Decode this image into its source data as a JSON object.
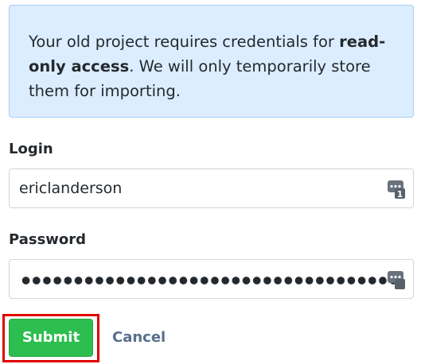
{
  "notice": {
    "text_before": "Your old project requires credentials for ",
    "text_bold": "read-only access",
    "text_after": ". We will only temporarily store them for importing."
  },
  "login": {
    "label": "Login",
    "value": "ericlanderson",
    "icon": "password-manager-icon"
  },
  "password": {
    "label": "Password",
    "masked": true,
    "icon": "password-manager-icon"
  },
  "actions": {
    "submit_label": "Submit",
    "cancel_label": "Cancel"
  },
  "colors": {
    "notice_bg": "#dbedff",
    "submit_bg": "#2cbe4e",
    "highlight": "#e00000",
    "cancel_text": "#586f8c"
  }
}
